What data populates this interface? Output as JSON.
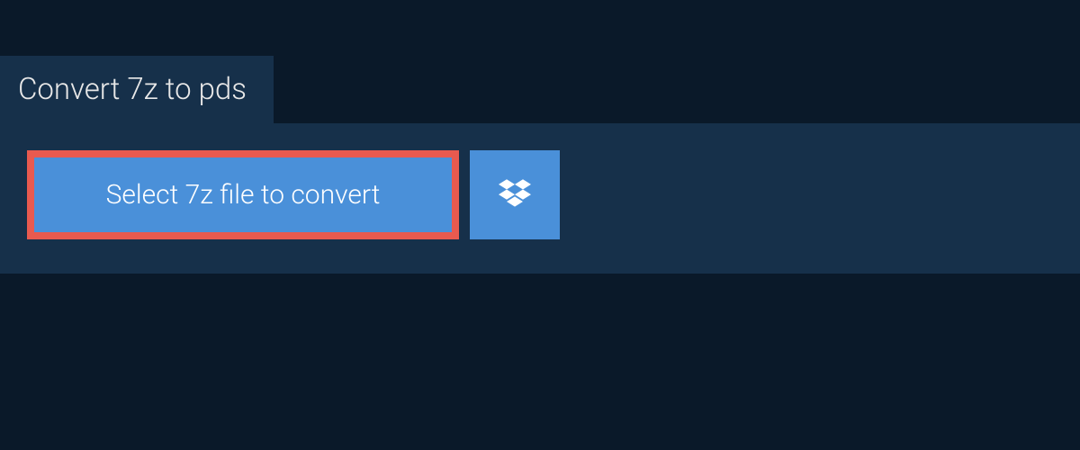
{
  "tab": {
    "title": "Convert 7z to pds"
  },
  "panel": {
    "select_label": "Select 7z file to convert"
  },
  "colors": {
    "background": "#0a1929",
    "panel": "#16304a",
    "button": "#4a90d9",
    "highlight_border": "#e85a4f"
  }
}
